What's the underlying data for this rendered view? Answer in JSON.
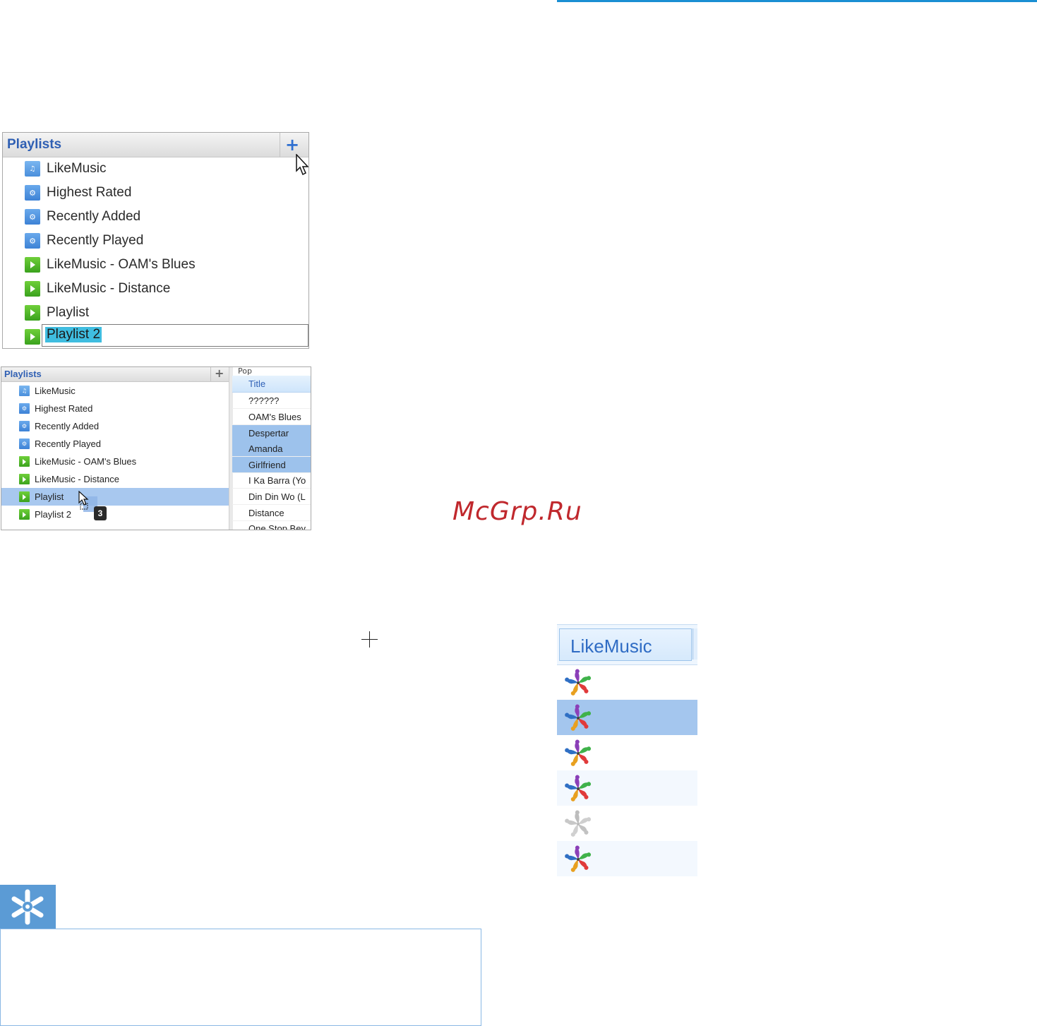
{
  "screenshot1": {
    "header_title": "Playlists",
    "add_icon": "plus-icon",
    "cursor_icon": "arrow-cursor-icon",
    "items": [
      {
        "label": "LikeMusic",
        "icon": "likemusic-playlist-icon"
      },
      {
        "label": "Highest Rated",
        "icon": "smart-playlist-icon"
      },
      {
        "label": "Recently Added",
        "icon": "smart-playlist-icon"
      },
      {
        "label": "Recently Played",
        "icon": "smart-playlist-icon"
      },
      {
        "label": "LikeMusic - OAM's Blues",
        "icon": "play-playlist-icon"
      },
      {
        "label": "LikeMusic - Distance",
        "icon": "play-playlist-icon"
      },
      {
        "label": "Playlist",
        "icon": "play-playlist-icon"
      }
    ],
    "editing_item": {
      "value": "Playlist 2",
      "icon": "play-playlist-icon"
    }
  },
  "screenshot2": {
    "header_title": "Playlists",
    "add_icon": "plus-icon",
    "items": [
      {
        "label": "LikeMusic",
        "icon": "likemusic-playlist-icon"
      },
      {
        "label": "Highest Rated",
        "icon": "smart-playlist-icon"
      },
      {
        "label": "Recently Added",
        "icon": "smart-playlist-icon"
      },
      {
        "label": "Recently Played",
        "icon": "smart-playlist-icon"
      },
      {
        "label": "LikeMusic - OAM's Blues",
        "icon": "play-playlist-icon"
      },
      {
        "label": "LikeMusic - Distance",
        "icon": "play-playlist-icon"
      },
      {
        "label": "Playlist",
        "icon": "play-playlist-icon",
        "selected": true
      },
      {
        "label": "Playlist 2",
        "icon": "play-playlist-icon"
      }
    ],
    "column_group": "Pop",
    "column_header": "Title",
    "tracks": [
      {
        "title": "??????",
        "selected": false
      },
      {
        "title": "OAM's Blues",
        "selected": false
      },
      {
        "title": "Despertar",
        "selected": true
      },
      {
        "title": "Amanda",
        "selected": true
      },
      {
        "title": "Girlfriend",
        "selected": true
      },
      {
        "title": "I Ka Barra (Yo",
        "selected": false
      },
      {
        "title": "Din Din Wo (L",
        "selected": false
      },
      {
        "title": "Distance",
        "selected": false
      },
      {
        "title": "One Stop Bey",
        "selected": false
      }
    ],
    "drag_count": "3"
  },
  "watermark": "McGrp.Ru",
  "screenshot3": {
    "column_header": "LikeMusic",
    "rows": [
      {
        "icon": "likemusic-icon",
        "state": "color",
        "selected": false
      },
      {
        "icon": "likemusic-icon",
        "state": "color",
        "selected": true
      },
      {
        "icon": "likemusic-icon",
        "state": "color",
        "selected": false
      },
      {
        "icon": "likemusic-icon",
        "state": "color",
        "selected": false
      },
      {
        "icon": "likemusic-icon",
        "state": "gray",
        "selected": false
      },
      {
        "icon": "likemusic-icon",
        "state": "color",
        "selected": false
      }
    ]
  },
  "tip": {
    "icon": "asterisk-icon"
  },
  "colors": {
    "accent_blue": "#1a8fd3",
    "selection_blue": "#a8c8ef",
    "rename_highlight": "#3fbde0",
    "tip_blue": "#5b9bd5",
    "watermark_red": "#c0282d"
  }
}
